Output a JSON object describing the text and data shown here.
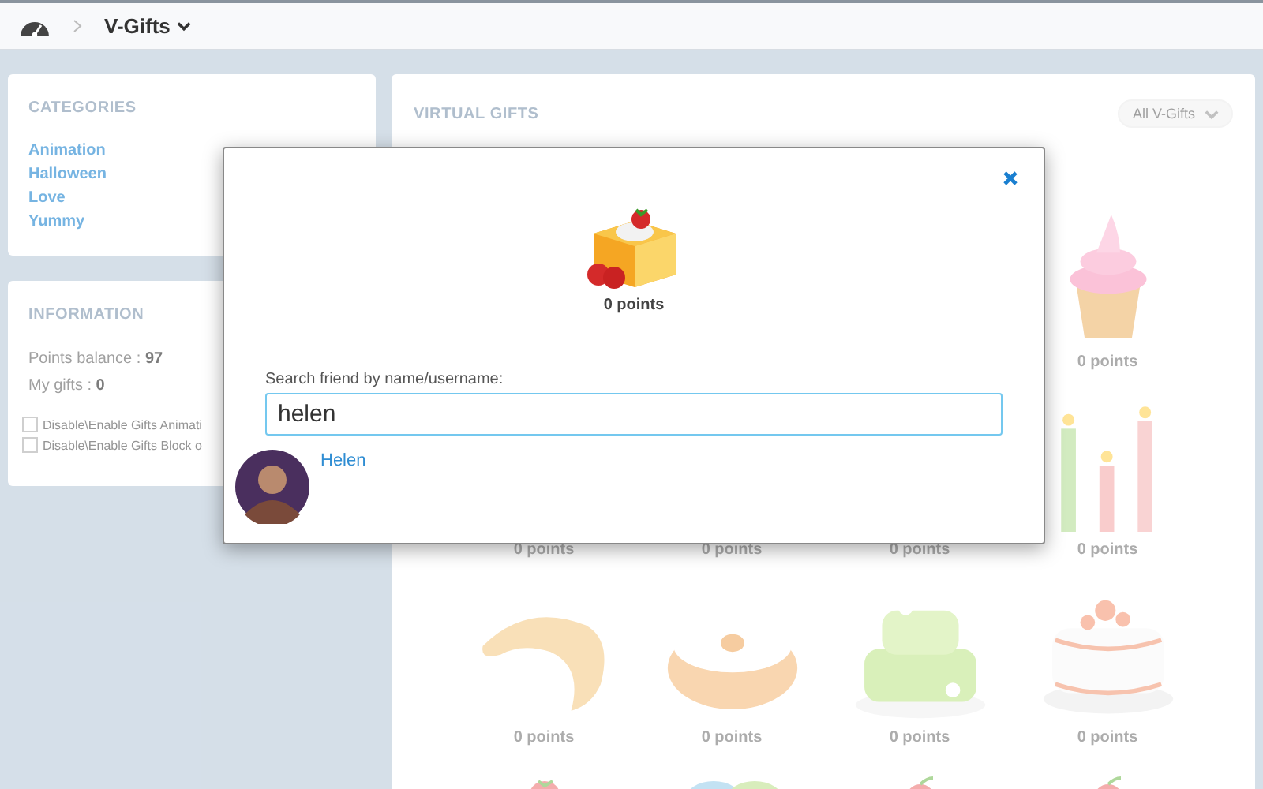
{
  "header": {
    "breadcrumb": "V-Gifts"
  },
  "categories": {
    "title": "CATEGORIES",
    "items": [
      "Animation",
      "Halloween",
      "Love",
      "Yummy"
    ]
  },
  "information": {
    "title": "INFORMATION",
    "stats": [
      "Points balance : **97**",
      "My gifts : **0**"
    ],
    "options": [
      {
        "label": "Disable\\Enable Gifts Animati",
        "checked": false
      },
      {
        "label": "Disable\\Enable Gifts Block o",
        "checked": false
      }
    ]
  },
  "gifts_panel": {
    "title": "VIRTUAL GIFTS",
    "filter": "All V-Gifts",
    "gifts": [
      {
        "kind": "covered"
      },
      {
        "kind": "covered"
      },
      {
        "kind": "covered"
      },
      {
        "kind": "cupcake",
        "points": "0 points"
      },
      {
        "points": "0 points"
      },
      {
        "points": "0 points"
      },
      {
        "points": "0 points"
      },
      {
        "kind": "candles",
        "points": "0 points"
      },
      {
        "kind": "croissant",
        "points": "0 points"
      },
      {
        "kind": "bundt",
        "points": "0 points"
      },
      {
        "kind": "tiered-cake",
        "points": "0 points"
      },
      {
        "kind": "rose-cake",
        "points": "0 points"
      },
      {
        "kind": "strawberry"
      },
      {
        "kind": "macarons"
      },
      {
        "kind": "cherry"
      },
      {
        "kind": "cherry"
      }
    ]
  },
  "dialog": {
    "gift_points": "0 points",
    "search_label": "Search friend by name/username:",
    "search_value": "helen",
    "results": [
      {
        "name": "Helen"
      }
    ]
  }
}
